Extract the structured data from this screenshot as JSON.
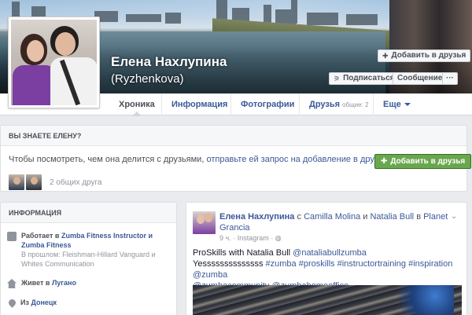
{
  "profile": {
    "name": "Елена Нахлупина",
    "alternate_name": "(Ryzhenkova)"
  },
  "cover_actions": {
    "add_friend": "Добавить в друзья",
    "follow": "Подписаться",
    "message": "Сообщение",
    "more": "···"
  },
  "tabs": [
    {
      "label": "Хроника",
      "active": true
    },
    {
      "label": "Информация"
    },
    {
      "label": "Фотографии"
    },
    {
      "label": "Друзья",
      "sub": "общие: 2"
    },
    {
      "label": "Еще"
    }
  ],
  "know_card": {
    "title": "ВЫ ЗНАЕТЕ ЕЛЕНУ?",
    "text_prefix": "Чтобы посмотреть, чем она делится с друзьями, ",
    "text_link": "отправьте ей запрос на добавление в друзья",
    "text_suffix": ".",
    "add_button": "Добавить в друзья",
    "mutual_friends": "2 общих друга"
  },
  "info_card": {
    "title": "ИНФОРМАЦИЯ",
    "work_prefix": "Работает в",
    "work_place": "Zumba Fitness Instructor и Zumba Fitness",
    "past_prefix": "В прошлом:",
    "past_places": "Fleishman-Hillard Vanguard и Whites Communication",
    "lives_prefix": "Живет в",
    "lives_place": "Лугано",
    "from_prefix": "Из",
    "from_place": "Донецк"
  },
  "post": {
    "author": "Елена Нахлупина",
    "with": "с",
    "tagged_1": "Camilla Molina",
    "and": "и",
    "tagged_2": "Natalia Bull",
    "in": "в",
    "place": "Planet Grancia",
    "time": "9 ч.",
    "source": "Instagram",
    "text_line1": "ProSkills with Natalia Bull ",
    "mention_1": "@nataliabullzumba",
    "text_line2_start": "Yessssssssssssss ",
    "hashtags": "#zumba #proskills #instructortraining #inspiration",
    "mention_2": " @zumba",
    "mention_3": "@zumbacommunity",
    "mention_4": " @zumbahomeoffice"
  }
}
